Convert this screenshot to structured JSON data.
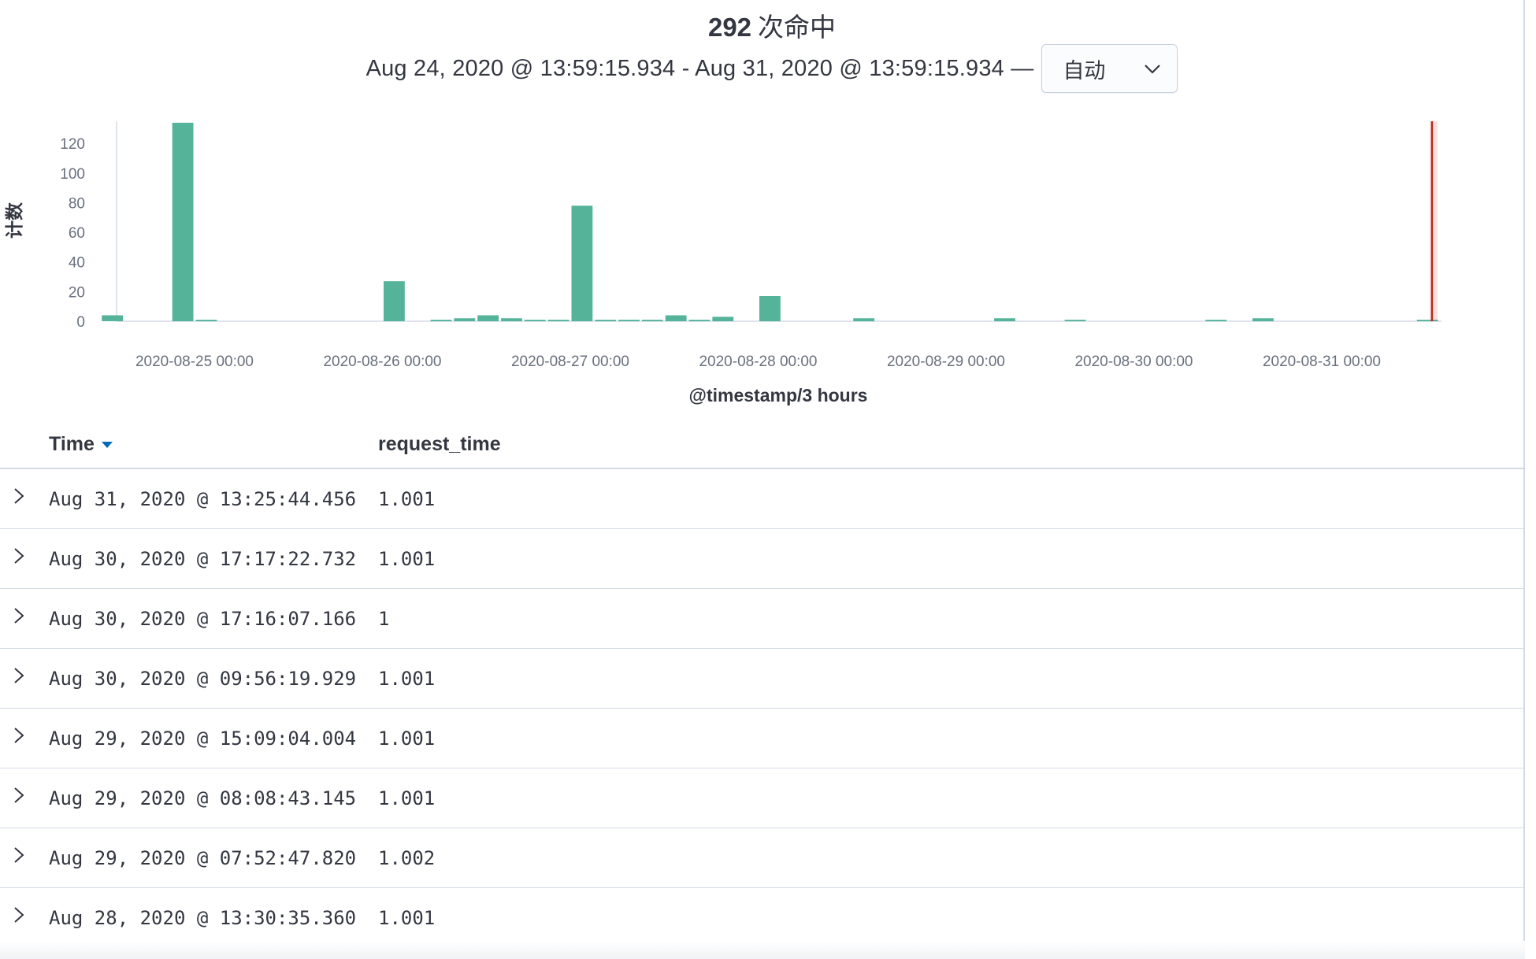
{
  "summary": {
    "hits": "292",
    "hits_label": "次命中"
  },
  "time_range": {
    "text": "Aug 24, 2020 @ 13:59:15.934 - Aug 31, 2020 @ 13:59:15.934 —"
  },
  "interval": {
    "selected": "自动"
  },
  "colors": {
    "bar": "#54b399",
    "now_marker": "#bd271e",
    "link": "#006bb8"
  },
  "chart_data": {
    "type": "bar",
    "xlabel": "@timestamp/3 hours",
    "ylabel": "计数",
    "ylim": [
      0,
      135
    ],
    "yticks": [
      0,
      20,
      40,
      60,
      80,
      100,
      120
    ],
    "x_tick_labels": [
      "2020-08-25 00:00",
      "2020-08-26 00:00",
      "2020-08-27 00:00",
      "2020-08-28 00:00",
      "2020-08-29 00:00",
      "2020-08-30 00:00",
      "2020-08-31 00:00"
    ],
    "bucket_hours": 3,
    "series": [
      {
        "x": [
          "2020-08-24 12:00",
          "2020-08-24 21:00",
          "2020-08-25 00:00",
          "2020-08-26 00:00",
          "2020-08-26 06:00",
          "2020-08-26 09:00",
          "2020-08-26 12:00",
          "2020-08-26 15:00",
          "2020-08-26 18:00",
          "2020-08-26 21:00",
          "2020-08-27 00:00",
          "2020-08-27 03:00",
          "2020-08-27 06:00",
          "2020-08-27 09:00",
          "2020-08-27 12:00",
          "2020-08-27 15:00",
          "2020-08-27 18:00",
          "2020-08-28 00:00",
          "2020-08-28 12:00",
          "2020-08-29 06:00",
          "2020-08-29 15:00",
          "2020-08-30 09:00",
          "2020-08-30 15:00",
          "2020-08-31 12:00"
        ],
        "values": [
          4,
          134,
          1,
          27,
          1,
          2,
          4,
          2,
          1,
          1,
          78,
          1,
          1,
          1,
          4,
          1,
          3,
          17,
          2,
          2,
          1,
          1,
          2,
          1
        ]
      }
    ],
    "now_marker": "Aug 31, 2020 @ 13:59:15.934"
  },
  "table": {
    "columns": [
      "Time",
      "request_time"
    ],
    "rows": [
      {
        "time": "Aug 31, 2020 @ 13:25:44.456",
        "request_time": "1.001"
      },
      {
        "time": "Aug 30, 2020 @ 17:17:22.732",
        "request_time": "1.001"
      },
      {
        "time": "Aug 30, 2020 @ 17:16:07.166",
        "request_time": "1"
      },
      {
        "time": "Aug 30, 2020 @ 09:56:19.929",
        "request_time": "1.001"
      },
      {
        "time": "Aug 29, 2020 @ 15:09:04.004",
        "request_time": "1.001"
      },
      {
        "time": "Aug 29, 2020 @ 08:08:43.145",
        "request_time": "1.001"
      },
      {
        "time": "Aug 29, 2020 @ 07:52:47.820",
        "request_time": "1.002"
      },
      {
        "time": "Aug 28, 2020 @ 13:30:35.360",
        "request_time": "1.001"
      }
    ]
  }
}
